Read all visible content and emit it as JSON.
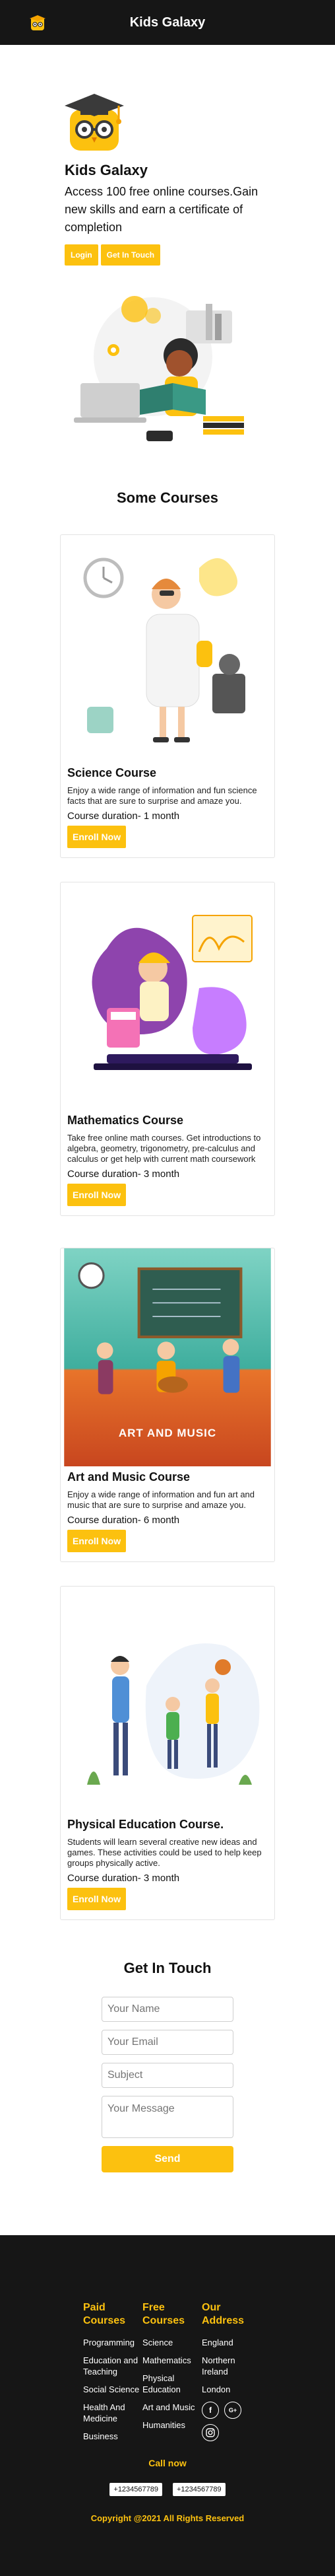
{
  "nav": {
    "title": "Kids Galaxy",
    "logo_icon": "kids-galaxy-logo-icon"
  },
  "hero": {
    "title": "Kids Galaxy",
    "subtitle": "Access 100 free online courses.Gain new skills and earn a certificate of completion",
    "login_label": "Login",
    "get_in_touch_label": "Get In Touch"
  },
  "courses_section": {
    "title": "Some Courses",
    "cards": [
      {
        "title": "Science Course",
        "description": "Enjoy a wide range of information and fun science facts that are sure to surprise and amaze you.",
        "duration": "Course duration- 1 month",
        "button": "Enroll Now"
      },
      {
        "title": "Mathematics Course",
        "description": "Take free online math courses. Get introductions to algebra, geometry, trigonometry, pre-calculus and calculus or get help with current math coursework",
        "duration": "Course duration- 3 month",
        "button": "Enroll Now"
      },
      {
        "title": "Art and Music Course",
        "description": "Enjoy a wide range of information and fun art and music that are sure to surprise and amaze you.",
        "duration": "Course duration- 6 month",
        "button": "Enroll Now",
        "banner_text": "ART AND MUSIC"
      },
      {
        "title": "Physical Education Course.",
        "description": "Students will learn several creative new ideas and games. These activities could be used to help keep groups physically active.",
        "duration": "Course duration- 3 month",
        "button": "Enroll Now"
      }
    ]
  },
  "contact": {
    "title": "Get In Touch",
    "name_placeholder": "Your Name",
    "email_placeholder": "Your Email",
    "subject_placeholder": "Subject",
    "message_placeholder": "Your Message",
    "send_label": "Send"
  },
  "footer": {
    "paid_courses": {
      "title": "Paid Courses",
      "items": [
        "Programming",
        "Education and Teaching",
        "Social Science",
        "Health And Medicine",
        "Business"
      ]
    },
    "free_courses": {
      "title": "Free Courses",
      "items": [
        "Science",
        "Mathematics",
        "Physical Education",
        "Art and Music",
        "Humanities"
      ]
    },
    "our_address": {
      "title": "Our Address",
      "items": [
        "England",
        "Northern Ireland",
        "London"
      ]
    },
    "social_icons": [
      "facebook-icon",
      "google-plus-icon",
      "instagram-icon"
    ],
    "social_glyphs": {
      "facebook": "f",
      "google": "G+"
    },
    "call_now": "Call now",
    "phones": [
      "+1234567789",
      "+1234567789"
    ],
    "copyright": "Copyright @2021 All Rights Reserved"
  },
  "colors": {
    "accent": "#fcc10f",
    "dark": "#161616"
  }
}
